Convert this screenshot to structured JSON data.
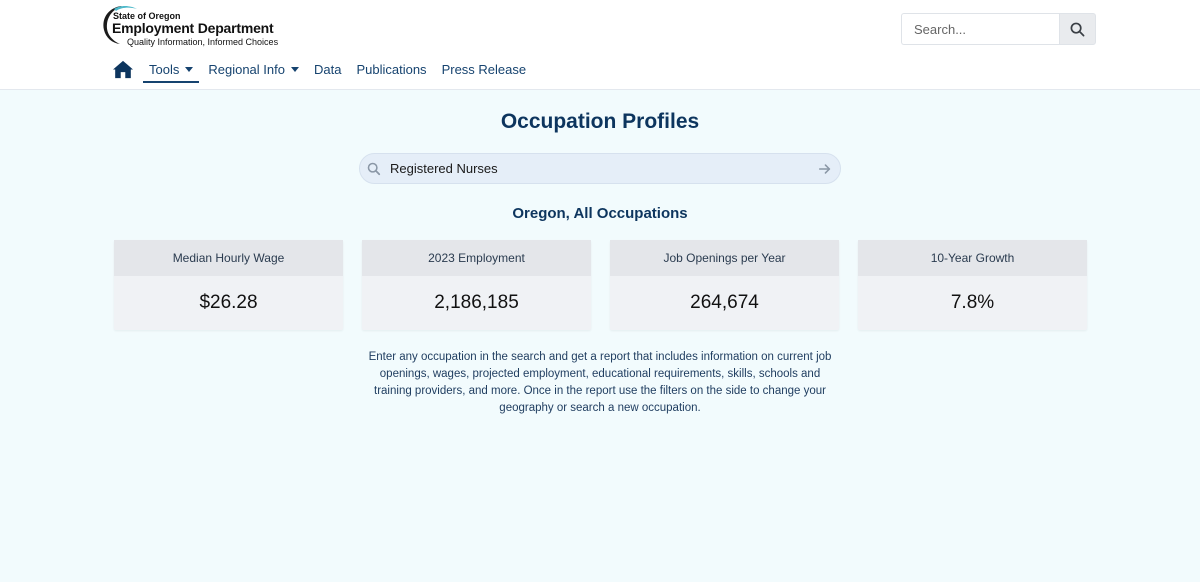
{
  "header": {
    "logo": {
      "line1": "State of Oregon",
      "line2": "Employment Department",
      "tagline": "Quality Information, Informed Choices"
    },
    "search": {
      "placeholder": "Search..."
    }
  },
  "nav": {
    "items": [
      {
        "label": "Tools",
        "dropdown": true,
        "active": true
      },
      {
        "label": "Regional Info",
        "dropdown": true
      },
      {
        "label": "Data"
      },
      {
        "label": "Publications"
      },
      {
        "label": "Press Release"
      }
    ]
  },
  "main": {
    "title": "Occupation Profiles",
    "occupation_search": {
      "value": "Registered Nurses"
    },
    "region_title": "Oregon, All Occupations",
    "cards": [
      {
        "label": "Median Hourly Wage",
        "value": "$26.28"
      },
      {
        "label": "2023 Employment",
        "value": "2,186,185"
      },
      {
        "label": "Job Openings per Year",
        "value": "264,674"
      },
      {
        "label": "10-Year Growth",
        "value": "7.8%"
      }
    ],
    "description": "Enter any occupation in the search and get a report that includes information on current job openings, wages, projected employment, educational requirements, skills, schools and training providers, and more. Once in the report use the filters on the side to change your geography or search a new occupation."
  },
  "colors": {
    "navy": "#0d355e",
    "nav_text": "#16436f",
    "page_bg": "#f2fbfd",
    "card_head": "#e4e6ea",
    "card_body": "#f0f2f5",
    "logo_accent": "#4db8c9"
  },
  "icons": [
    "home-icon",
    "search-icon",
    "caret-down-icon",
    "arrow-right-icon",
    "logo-swoosh-icon"
  ]
}
